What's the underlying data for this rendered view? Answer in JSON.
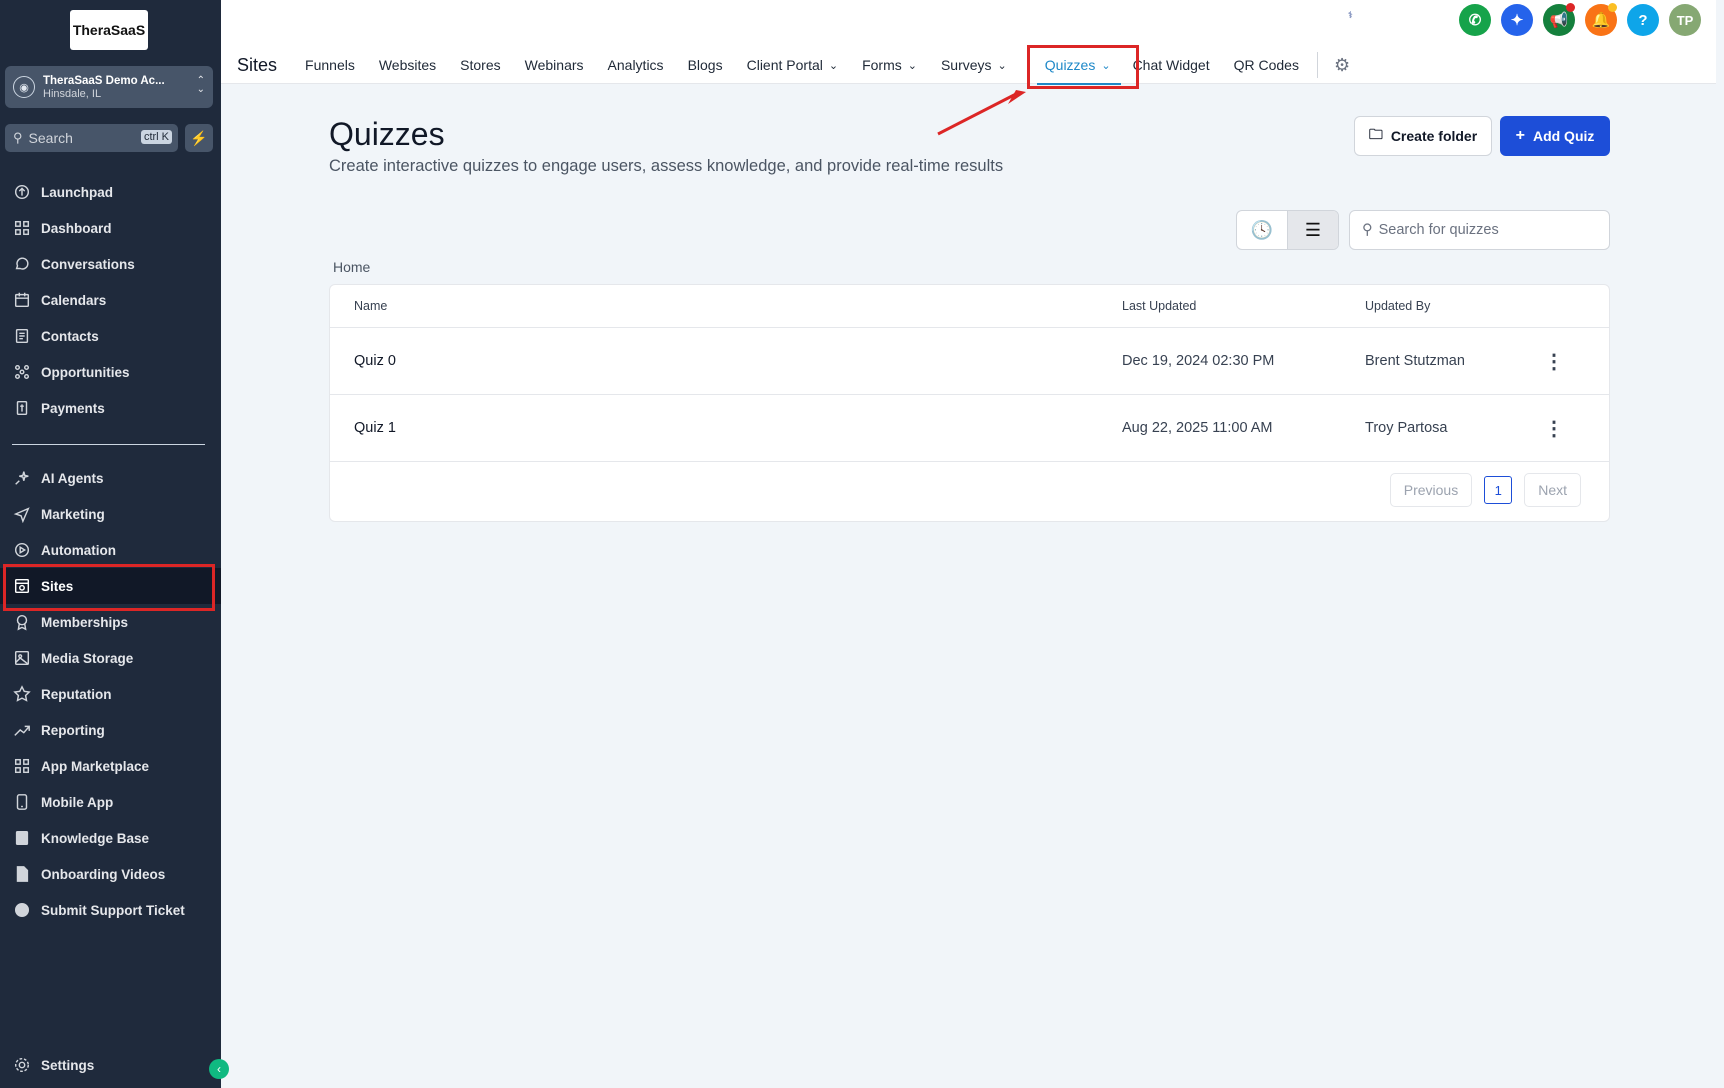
{
  "sidebar": {
    "logo_text": "TheraSaaS",
    "account": {
      "name": "TheraSaaS Demo Ac...",
      "location": "Hinsdale, IL"
    },
    "search": {
      "placeholder": "Search",
      "shortcut": "ctrl K"
    },
    "items_top": [
      {
        "label": "Launchpad",
        "icon": "rocket-icon"
      },
      {
        "label": "Dashboard",
        "icon": "grid-icon"
      },
      {
        "label": "Conversations",
        "icon": "chat-icon"
      },
      {
        "label": "Calendars",
        "icon": "calendar-icon"
      },
      {
        "label": "Contacts",
        "icon": "contacts-icon"
      },
      {
        "label": "Opportunities",
        "icon": "opportunities-icon"
      },
      {
        "label": "Payments",
        "icon": "payments-icon"
      }
    ],
    "items_bottom": [
      {
        "label": "AI Agents",
        "icon": "sparkle-icon"
      },
      {
        "label": "Marketing",
        "icon": "send-icon"
      },
      {
        "label": "Automation",
        "icon": "automation-icon"
      },
      {
        "label": "Sites",
        "icon": "sites-icon"
      },
      {
        "label": "Memberships",
        "icon": "award-icon"
      },
      {
        "label": "Media Storage",
        "icon": "image-icon"
      },
      {
        "label": "Reputation",
        "icon": "star-icon"
      },
      {
        "label": "Reporting",
        "icon": "trend-icon"
      },
      {
        "label": "App Marketplace",
        "icon": "apps-icon"
      },
      {
        "label": "Mobile App",
        "icon": "mobile-icon"
      },
      {
        "label": "Knowledge Base",
        "icon": "book-icon"
      },
      {
        "label": "Onboarding Videos",
        "icon": "video-file-icon"
      },
      {
        "label": "Submit Support Ticket",
        "icon": "headset-icon"
      }
    ],
    "settings_label": "Settings"
  },
  "header": {
    "section_title": "Sites",
    "tabs": [
      {
        "label": "Funnels"
      },
      {
        "label": "Websites"
      },
      {
        "label": "Stores"
      },
      {
        "label": "Webinars"
      },
      {
        "label": "Analytics"
      },
      {
        "label": "Blogs"
      },
      {
        "label": "Client Portal"
      },
      {
        "label": "Forms"
      },
      {
        "label": "Surveys"
      },
      {
        "label": "Quizzes"
      },
      {
        "label": "Chat Widget"
      },
      {
        "label": "QR Codes"
      }
    ],
    "user_initials": "TP",
    "help_label": "?"
  },
  "main": {
    "title": "Quizzes",
    "subtitle": "Create interactive quizzes to engage users, assess knowledge, and provide real-time results",
    "create_folder_label": "Create folder",
    "add_quiz_label": "Add Quiz",
    "search_placeholder": "Search for quizzes",
    "breadcrumb": "Home",
    "table": {
      "columns": [
        "Name",
        "Last Updated",
        "Updated By"
      ],
      "rows": [
        {
          "name": "Quiz 0",
          "updated": "Dec 19, 2024 02:30 PM",
          "by": "Brent Stutzman"
        },
        {
          "name": "Quiz 1",
          "updated": "Aug 22, 2025 11:00 AM",
          "by": "Troy Partosa"
        }
      ]
    },
    "pagination": {
      "previous": "Previous",
      "page": "1",
      "next": "Next"
    }
  },
  "colors": {
    "accent": "#1d4ed8",
    "highlight": "#dc2626",
    "sidebar_bg": "#1f2a3c",
    "active_tab": "#1e88c8"
  }
}
